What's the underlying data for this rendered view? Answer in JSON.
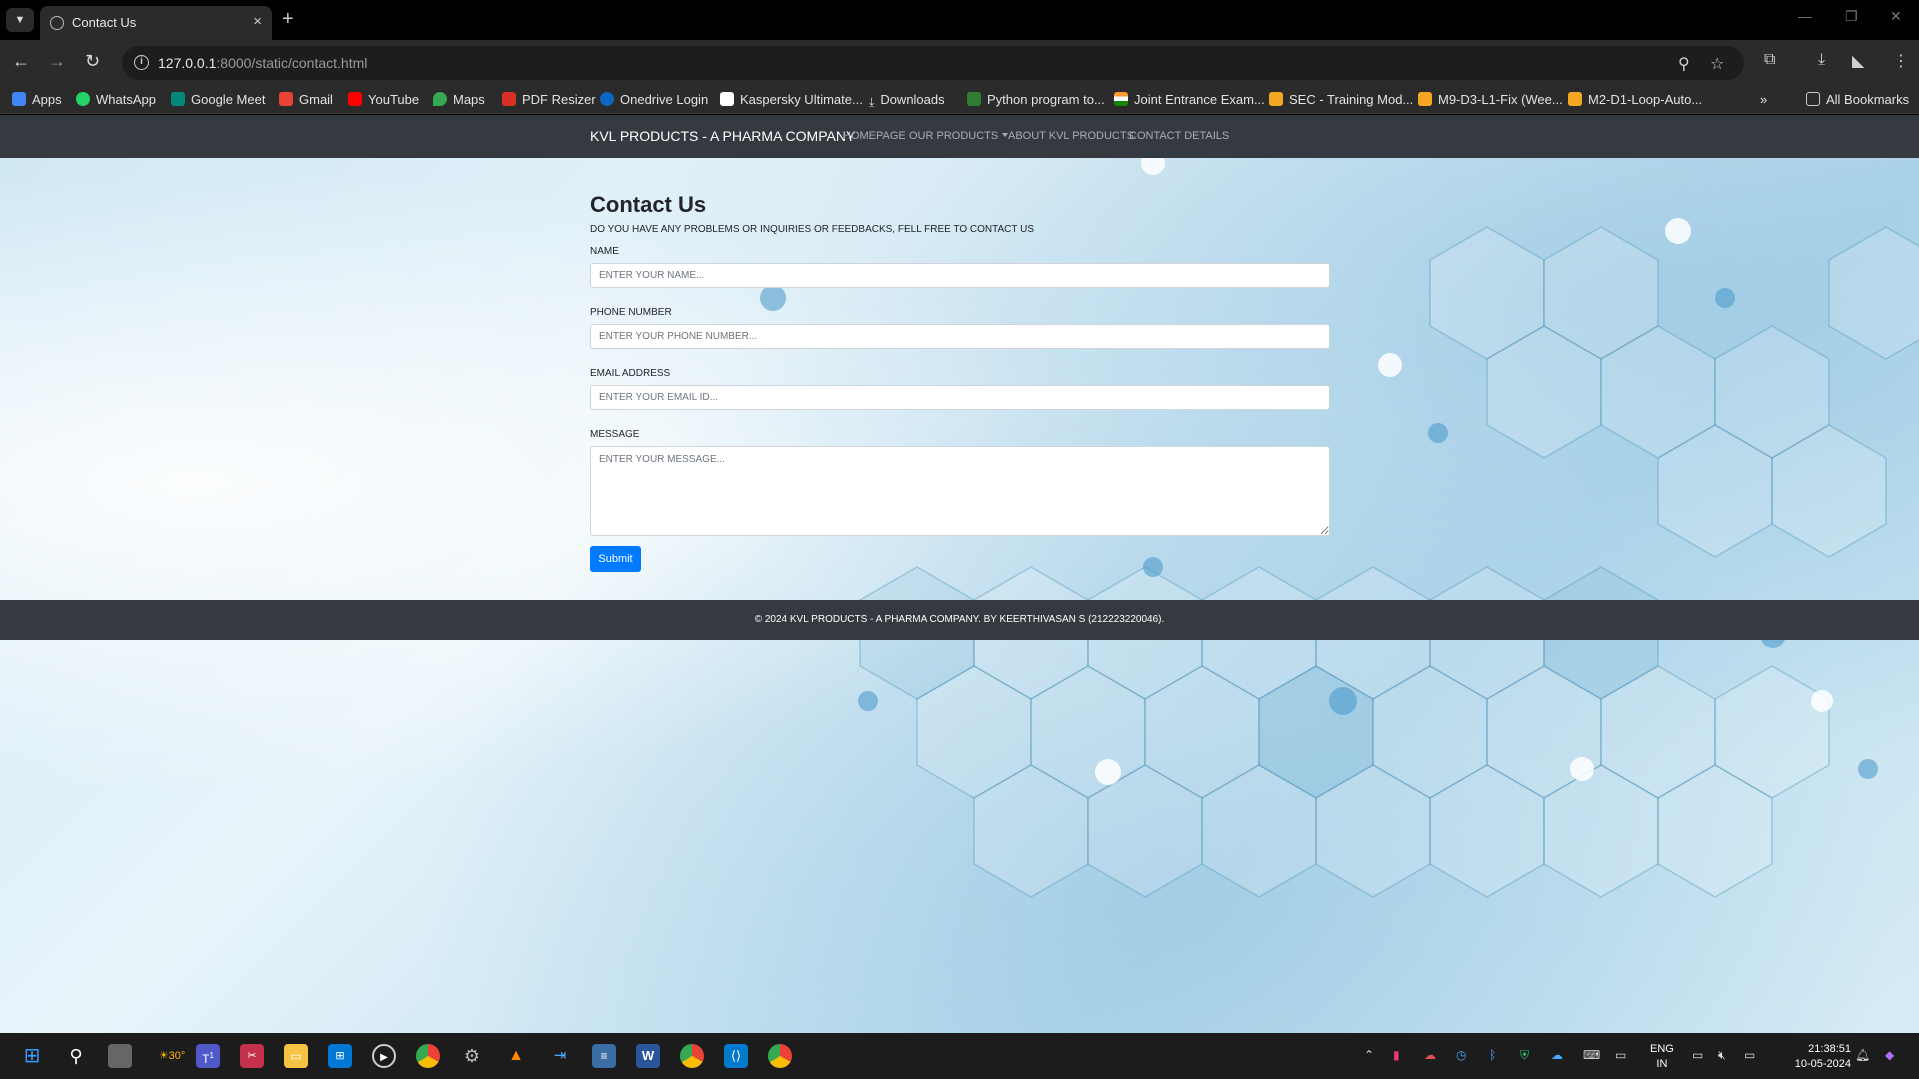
{
  "browser": {
    "tab_title": "Contact Us",
    "url_host": "127.0.0.1",
    "url_rest": ":8000/static/contact.html",
    "bookmarks": [
      {
        "label": "Apps",
        "color": "#4285f4"
      },
      {
        "label": "WhatsApp",
        "color": "#25d366"
      },
      {
        "label": "Google Meet",
        "color": "#00897b"
      },
      {
        "label": "Gmail",
        "color": "#ea4335"
      },
      {
        "label": "YouTube",
        "color": "#ff0000"
      },
      {
        "label": "Maps",
        "color": "#34a853"
      },
      {
        "label": "PDF Resizer",
        "color": "#d93025"
      },
      {
        "label": "Onedrive Login",
        "color": "#0a66c2"
      },
      {
        "label": "Kaspersky Ultimate...",
        "color": "#ffffff"
      },
      {
        "label": "Downloads",
        "color": "#e0e0e0"
      },
      {
        "label": "Python program to...",
        "color": "#2e7d32"
      },
      {
        "label": "Joint Entrance Exam...",
        "color": "#ff9933"
      },
      {
        "label": "SEC - Training Mod...",
        "color": "#f5a623"
      },
      {
        "label": "M9-D3-L1-Fix (Wee...",
        "color": "#f5a623"
      },
      {
        "label": "M2-D1-Loop-Auto...",
        "color": "#f5a623"
      }
    ],
    "more_bookmarks": "»",
    "all_bookmarks": "All Bookmarks"
  },
  "site_nav": {
    "brand": "KVL PRODUCTS - A PHARMA COMPANY",
    "links": [
      "HOMEPAGE",
      "OUR PRODUCTS",
      "ABOUT KVL PRODUCTS",
      "CONTACT DETAILS"
    ]
  },
  "contact": {
    "title": "Contact Us",
    "lead": "DO YOU HAVE ANY PROBLEMS OR INQUIRIES OR FEEDBACKS, FELL FREE TO CONTACT US",
    "fields": [
      {
        "label": "NAME",
        "placeholder": "ENTER YOUR NAME..."
      },
      {
        "label": "PHONE NUMBER",
        "placeholder": "ENTER YOUR PHONE NUMBER..."
      },
      {
        "label": "EMAIL ADDRESS",
        "placeholder": "ENTER YOUR EMAIL ID..."
      },
      {
        "label": "MESSAGE",
        "placeholder": "ENTER YOUR MESSAGE..."
      }
    ],
    "submit_label": "Submit"
  },
  "footer": {
    "text": "© 2024 KVL PRODUCTS - A PHARMA COMPANY. BY KEERTHIVASAN S (212223220046)."
  },
  "taskbar": {
    "weather": "30°",
    "teams_badge": "1",
    "lang_line1": "ENG",
    "lang_line2": "IN",
    "time": "21:38:51",
    "date": "10-05-2024"
  },
  "colors": {
    "site_nav_bg": "#343a40",
    "primary_button": "#007bff"
  }
}
